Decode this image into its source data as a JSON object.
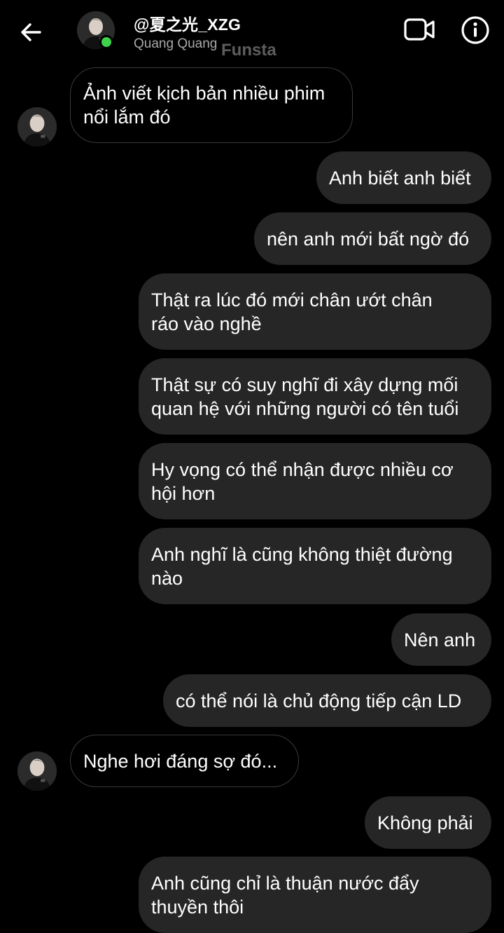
{
  "header": {
    "handle": "@夏之光_XZG",
    "name": "Quang Quang",
    "watermark": "Funsta",
    "icons": {
      "back": "arrow-left-icon",
      "video": "video-camera-icon",
      "info": "info-circle-icon"
    },
    "status": "online"
  },
  "colors": {
    "background": "#000000",
    "outgoing_bubble": "#262626",
    "incoming_border": "#3a3a3a",
    "online": "#3dd34a",
    "secondary_text": "#a8a8a8"
  },
  "messages": [
    {
      "direction": "in",
      "text": "Ảnh viết kịch bản nhiều phim\nnổi lắm đó"
    },
    {
      "direction": "out",
      "text": "Anh biết anh biết"
    },
    {
      "direction": "out",
      "text": "nên anh mới bất ngờ đó"
    },
    {
      "direction": "out",
      "text": "Thật ra lúc đó mới chân ướt chân\nráo vào nghề"
    },
    {
      "direction": "out",
      "text": "Thật sự có suy nghĩ đi xây dựng mối\nquan hệ với những người có tên tuổi"
    },
    {
      "direction": "out",
      "text": "Hy vọng có thể nhận được nhiều cơ\nhội hơn"
    },
    {
      "direction": "out",
      "text": "Anh nghĩ là cũng không thiệt đường\nnào"
    },
    {
      "direction": "out",
      "text": "Nên anh"
    },
    {
      "direction": "out",
      "text": "có thể nói là chủ động tiếp cận LD"
    },
    {
      "direction": "in",
      "text": "Nghe hơi đáng sợ đó..."
    },
    {
      "direction": "out",
      "text": "Không phải"
    },
    {
      "direction": "out",
      "text": "Anh cũng chỉ là thuận nước đẩy\nthuyền thôi"
    }
  ]
}
